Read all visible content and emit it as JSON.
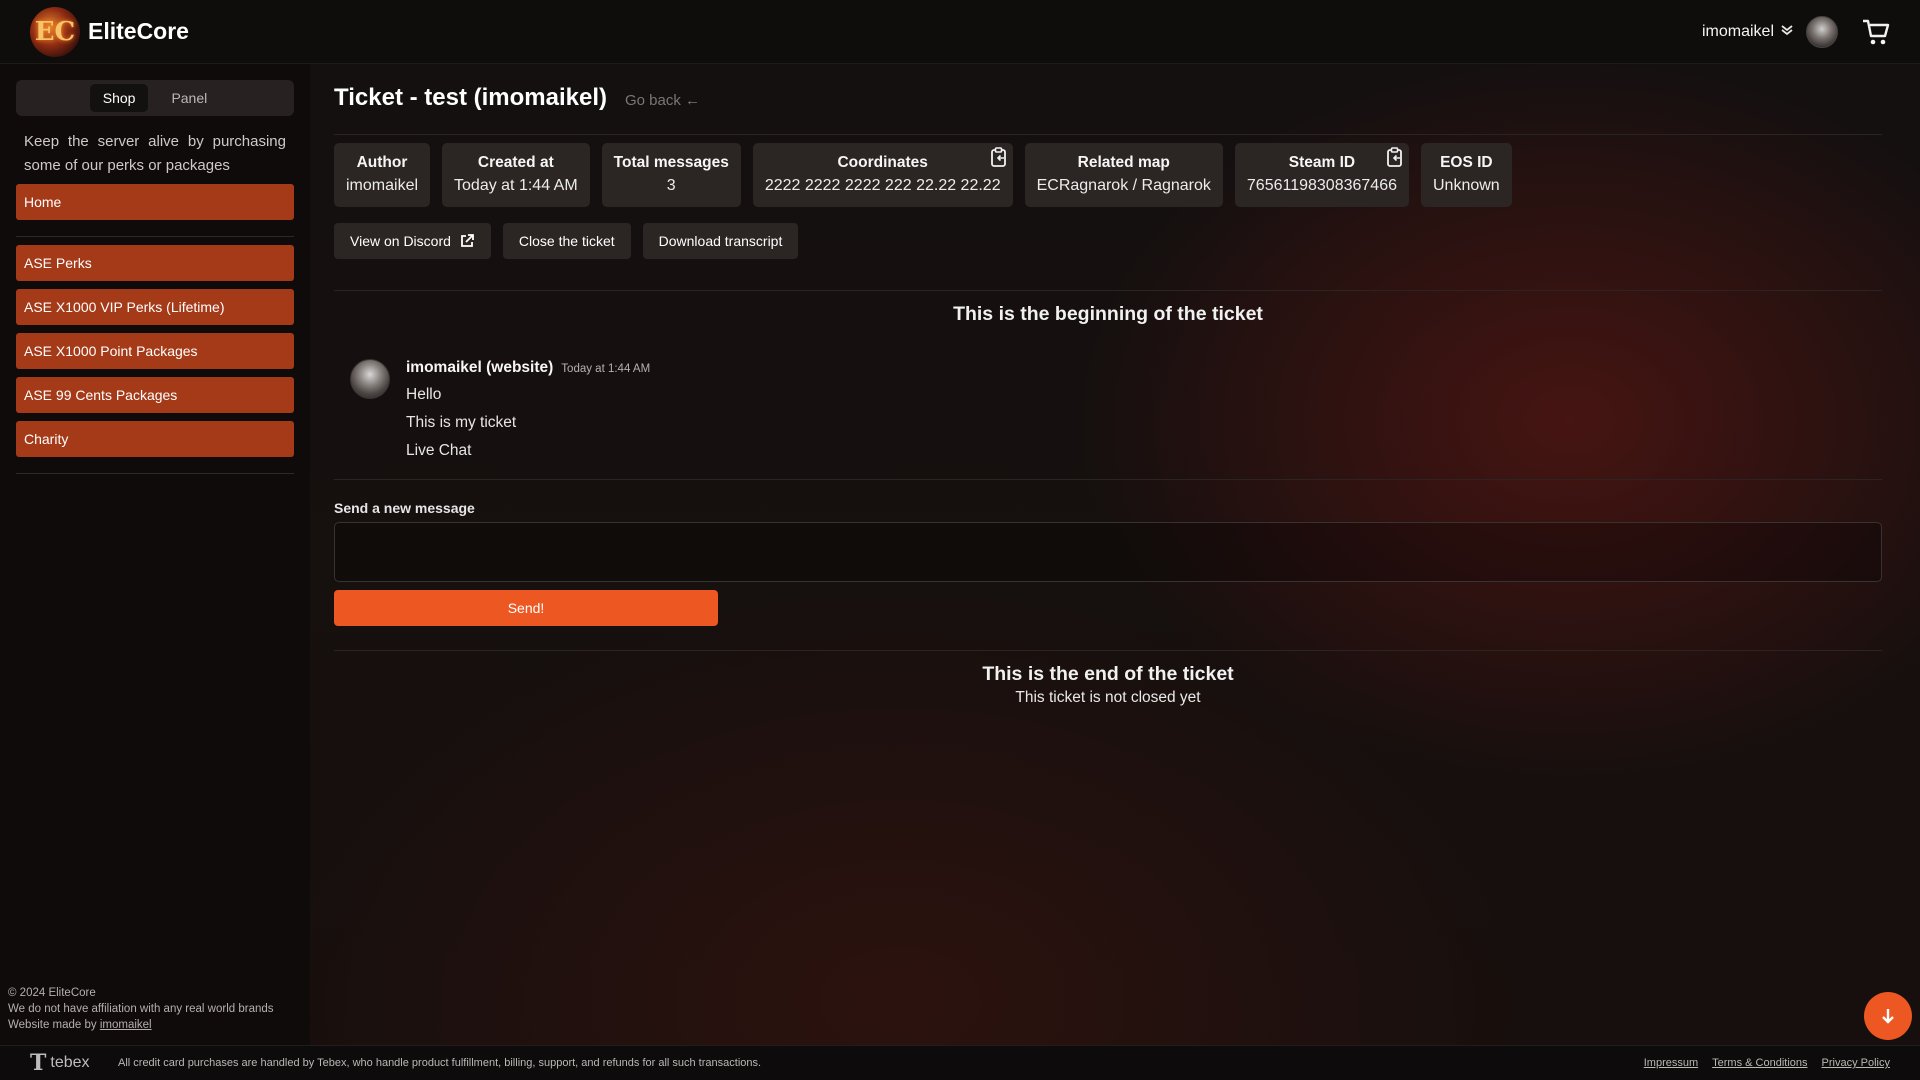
{
  "header": {
    "brand": "EliteCore",
    "logo_text": "EC",
    "user": "imomaikel",
    "chevron": "»"
  },
  "sidebar": {
    "toggle": [
      "Shop",
      "Panel"
    ],
    "active_toggle": "Shop",
    "promo": "Keep the server alive by purchasing some of our perks or packages",
    "home": "Home",
    "items": [
      "ASE Perks",
      "ASE X1000 VIP Perks (Lifetime)",
      "ASE X1000 Point Packages",
      "ASE 99 Cents Packages",
      "Charity"
    ],
    "footer": {
      "copyright": "© 2024 EliteCore",
      "disclaimer": "We do not have affiliation with any real world brands",
      "made_by_prefix": "Website made by",
      "made_by_link": "imomaikel"
    }
  },
  "ticket": {
    "title": "Ticket - test (imomaikel)",
    "go_back": "Go back ←",
    "info": [
      {
        "label": "Author",
        "value": "imomaikel"
      },
      {
        "label": "Created at",
        "value": "Today at 1:44 AM"
      },
      {
        "label": "Total messages",
        "value": "3"
      },
      {
        "label": "Coordinates",
        "value": "2222 2222 2222 222 22.22 22.22"
      },
      {
        "label": "Related map",
        "value": "ECRagnarok / Ragnarok"
      },
      {
        "label": "Steam ID",
        "value": "76561198308367466"
      },
      {
        "label": "EOS ID",
        "value": "Unknown"
      }
    ],
    "actions": {
      "discord": "View on Discord",
      "close": "Close the ticket",
      "transcript": "Download transcript"
    },
    "beginning": "This is the beginning of the ticket",
    "message": {
      "author": "imomaikel (website)",
      "time": "Today at 1:44 AM",
      "lines": [
        "Hello",
        "This is my ticket",
        "Live Chat"
      ]
    },
    "send_label": "Send a new message",
    "send_button": "Send!",
    "end_title": "This is the end of the ticket",
    "end_sub": "This ticket is not closed yet"
  },
  "footer": {
    "tebex": "tebex",
    "legal": "All credit card purchases are handled by Tebex, who handle product fulfillment, billing, support, and refunds for all such transactions.",
    "links": [
      "Impressum",
      "Terms & Conditions",
      "Privacy Policy"
    ]
  },
  "colors": {
    "accent": "#ec5722",
    "nav_item": "#a53a18",
    "card": "#2b2523"
  }
}
